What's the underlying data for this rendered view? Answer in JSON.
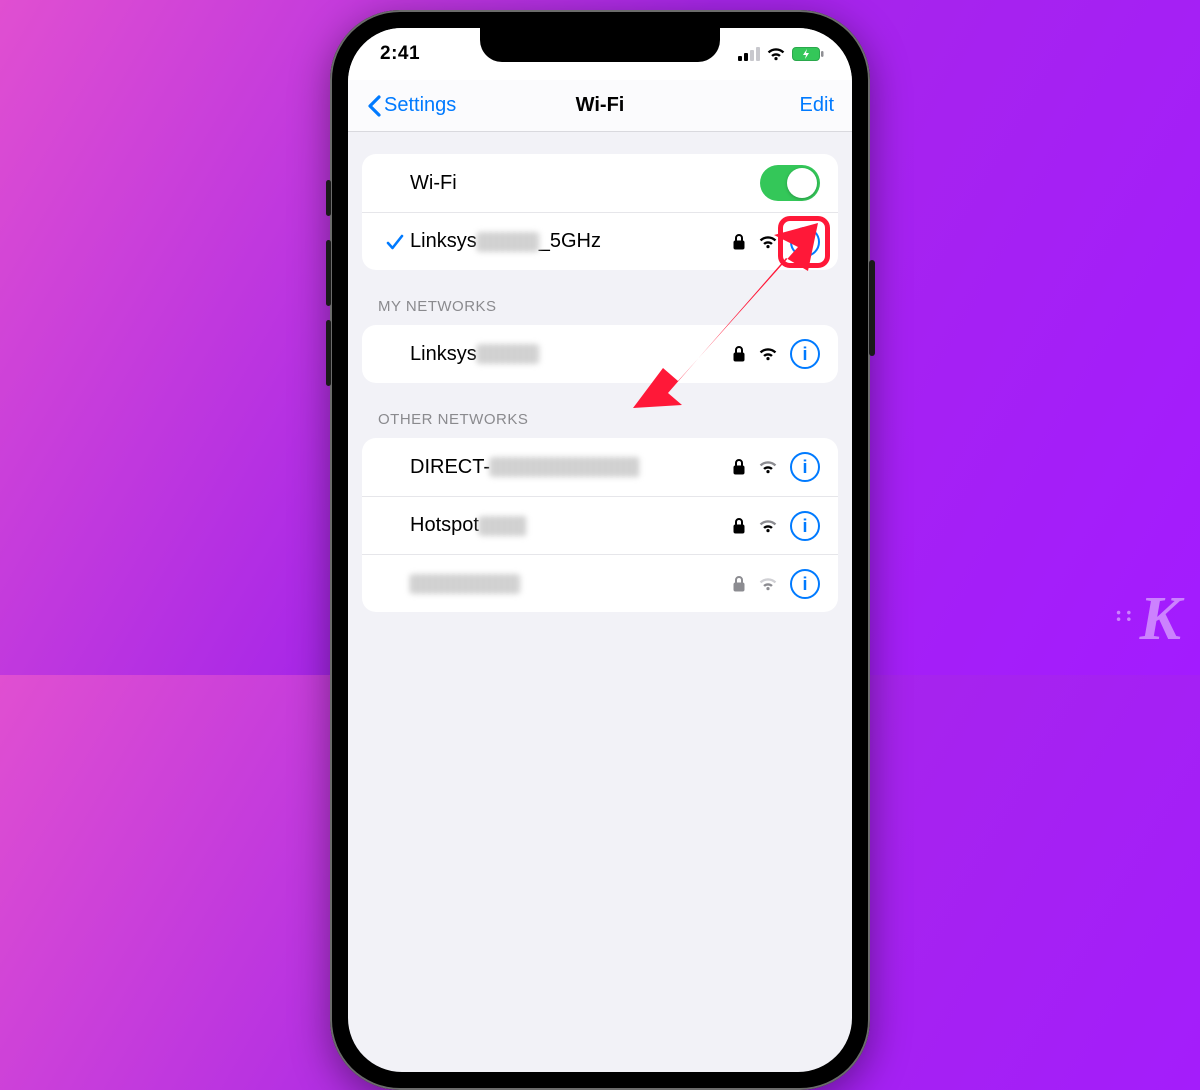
{
  "statusbar": {
    "time": "2:41"
  },
  "nav": {
    "back": "Settings",
    "title": "Wi-Fi",
    "edit": "Edit"
  },
  "wifi_row": {
    "label": "Wi-Fi"
  },
  "connected": {
    "prefix": "Linksys",
    "suffix": "_5GHz"
  },
  "sections": {
    "my": {
      "header": "My Networks",
      "item0_prefix": "Linksys"
    },
    "other": {
      "header": "Other Networks",
      "item0_prefix": "DIRECT-",
      "item1_prefix": "Hotspot"
    }
  },
  "watermark": "K"
}
